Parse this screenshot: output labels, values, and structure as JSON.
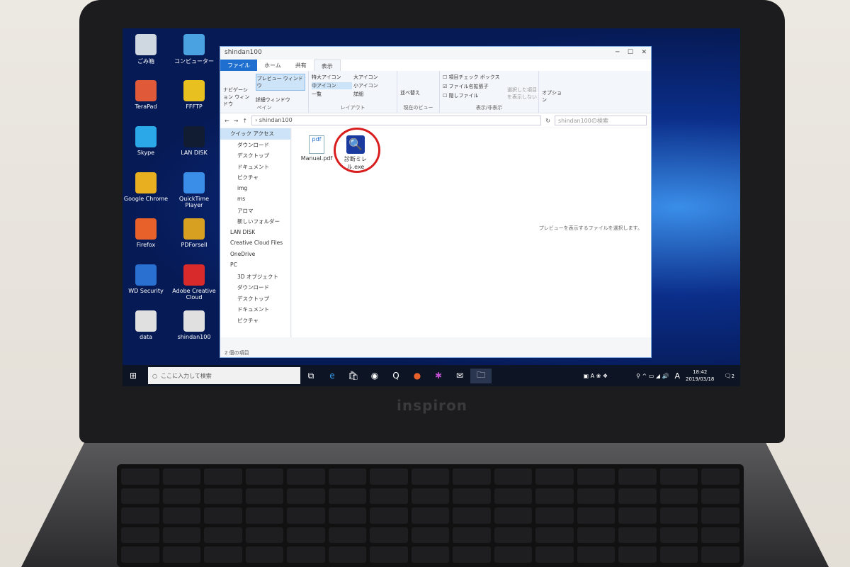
{
  "desktop": {
    "icons": [
      {
        "label": "ごみ箱",
        "color": "#cfd8e0"
      },
      {
        "label": "コンピューター",
        "color": "#4aa3e0"
      },
      {
        "label": "TeraPad",
        "color": "#e05a3a"
      },
      {
        "label": "FFFTP",
        "color": "#e8c020"
      },
      {
        "label": "Skype",
        "color": "#2aa8e8"
      },
      {
        "label": "LAN DISK",
        "color": "#111c33"
      },
      {
        "label": "Google Chrome",
        "color": "#e8b020"
      },
      {
        "label": "QuickTime Player",
        "color": "#3a8ee8"
      },
      {
        "label": "Firefox",
        "color": "#e8602a"
      },
      {
        "label": "PDForsell",
        "color": "#d8a020"
      },
      {
        "label": "WD Security",
        "color": "#2a70d0"
      },
      {
        "label": "Adobe Creative Cloud",
        "color": "#d82a2a"
      },
      {
        "label": "data",
        "color": "#e0e0e0"
      },
      {
        "label": "shindan100",
        "color": "#e0e0e0"
      }
    ]
  },
  "explorer": {
    "title": "shindan100",
    "tabs": [
      "ファイル",
      "ホーム",
      "共有",
      "表示"
    ],
    "ribbon": {
      "pane": {
        "caption": "ペイン",
        "nav": "ナビゲーション ウィンドウ",
        "preview": "プレビュー ウィンドウ",
        "details": "詳細ウィンドウ"
      },
      "layout": {
        "caption": "レイアウト",
        "items": [
          "特大アイコン",
          "大アイコン",
          "中アイコン",
          "小アイコン",
          "一覧",
          "詳細"
        ]
      },
      "view": {
        "caption": "現在のビュー",
        "sort": "並べ替え"
      },
      "show": {
        "caption": "表示/非表示",
        "checkbox": "項目チェック ボックス",
        "ext": "ファイル名拡張子",
        "hidden": "隠しファイル",
        "hide_selected": "選択した項目を表示しない"
      },
      "options": "オプション"
    },
    "address": "shindan100",
    "search_placeholder": "shindan100の検索",
    "nav": [
      "クイック アクセス",
      "ダウンロード",
      "デスクトップ",
      "ドキュメント",
      "ピクチャ",
      "img",
      "ms",
      "アロマ",
      "新しいフォルダー",
      "LAN DISK",
      "Creative Cloud Files",
      "OneDrive",
      "PC",
      "3D オブジェクト",
      "ダウンロード",
      "デスクトップ",
      "ドキュメント",
      "ピクチャ"
    ],
    "files": [
      {
        "name": "Manual.pdf"
      },
      {
        "name": "診断ミレル.exe"
      }
    ],
    "preview_text": "プレビューを表示するファイルを選択します。",
    "status": "2 個の項目"
  },
  "taskbar": {
    "search_placeholder": "ここに入力して検索",
    "time": "18:42",
    "date": "2019/03/18",
    "ime": "A",
    "notifications": "2"
  },
  "brand": "inspiron",
  "highlight_color": "#d81e1e"
}
